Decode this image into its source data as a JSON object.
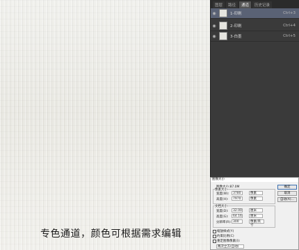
{
  "caption": "专色通道，颜色可根据需求编辑",
  "panel": {
    "tabs": [
      "图层",
      "路径",
      "通道",
      "历史记录"
    ],
    "active_tab_index": 2,
    "channels": [
      {
        "name": "1-印刷",
        "shortcut": "Ctrl+3",
        "selected": true
      },
      {
        "name": "2-印刷",
        "shortcut": "Ctrl+4",
        "selected": false
      },
      {
        "name": "3-白墨",
        "shortcut": "Ctrl+5",
        "selected": false
      }
    ]
  },
  "dialog": {
    "title": "图像大小",
    "size_text": "图像大小:87.0M",
    "pixel_dims_label": "像素大小",
    "width_label": "宽度(W):",
    "width_value": "3780",
    "height_label": "高度(H):",
    "height_value": "7970",
    "unit_px": "像素",
    "doc_size_label": "文档大小",
    "doc_width_label": "宽度(D):",
    "doc_width_value": "32.00",
    "doc_height_label": "高度(G):",
    "doc_height_value": "64.16",
    "unit_cm": "厘米",
    "resolution_label": "分辨率(R):",
    "resolution_value": "300",
    "resolution_unit": "像素/英寸",
    "buttons": [
      "确定",
      "取消",
      "自动(A)..."
    ],
    "checkboxes": [
      "缩放样式(Y)",
      "约束比例(C)",
      "重定图像像素(I):"
    ],
    "resample_value": "两次立方(自动)"
  }
}
